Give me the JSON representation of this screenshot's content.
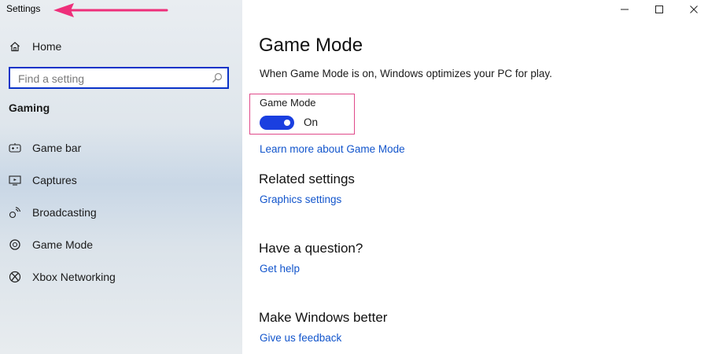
{
  "window": {
    "title": "Settings",
    "controls": {
      "minimize": "—",
      "maximize": "☐",
      "close": "✕"
    }
  },
  "sidebar": {
    "home_label": "Home",
    "search": {
      "placeholder": "Find a setting",
      "value": ""
    },
    "section_title": "Gaming",
    "items": [
      {
        "label": "Game bar",
        "icon": "game-bar-icon"
      },
      {
        "label": "Captures",
        "icon": "captures-icon"
      },
      {
        "label": "Broadcasting",
        "icon": "broadcasting-icon"
      },
      {
        "label": "Game Mode",
        "icon": "game-mode-icon"
      },
      {
        "label": "Xbox Networking",
        "icon": "xbox-icon"
      }
    ]
  },
  "main": {
    "title": "Game Mode",
    "description": "When Game Mode is on, Windows optimizes your PC for play.",
    "toggle": {
      "label": "Game Mode",
      "state_text": "On",
      "on": true
    },
    "learn_more": "Learn more about Game Mode",
    "related": {
      "heading": "Related settings",
      "link": "Graphics settings"
    },
    "question": {
      "heading": "Have a question?",
      "link": "Get help"
    },
    "feedback": {
      "heading": "Make Windows better",
      "link": "Give us feedback"
    }
  },
  "colors": {
    "accent": "#1a3fe0",
    "link": "#1255cc",
    "highlight_box": "#e04a8a",
    "arrow": "#ee2f7a"
  }
}
